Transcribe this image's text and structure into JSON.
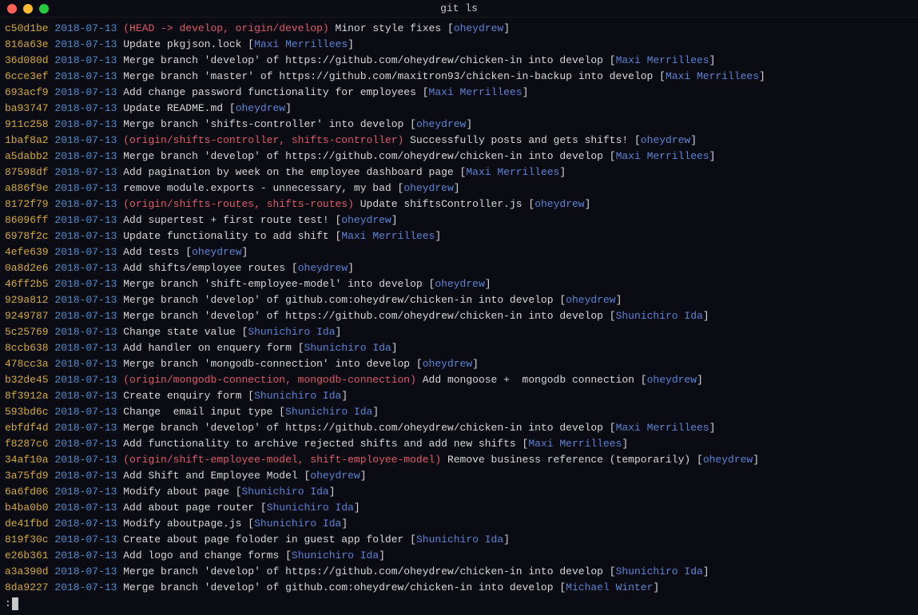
{
  "window": {
    "title": "git ls"
  },
  "commits": [
    {
      "hash": "c50d1be",
      "date": "2018-07-13",
      "refs": "(HEAD -> develop, origin/develop)",
      "msg": "Minor style fixes",
      "author": "oheydrew"
    },
    {
      "hash": "816a63e",
      "date": "2018-07-13",
      "refs": "",
      "msg": "Update pkgjson.lock",
      "author": "Maxi Merrillees"
    },
    {
      "hash": "36d080d",
      "date": "2018-07-13",
      "refs": "",
      "msg": "Merge branch 'develop' of https://github.com/oheydrew/chicken-in into develop",
      "author": "Maxi Merrillees"
    },
    {
      "hash": "6cce3ef",
      "date": "2018-07-13",
      "refs": "",
      "msg": "Merge branch 'master' of https://github.com/maxitron93/chicken-in-backup into develop",
      "author": "Maxi Merrillees"
    },
    {
      "hash": "693acf9",
      "date": "2018-07-13",
      "refs": "",
      "msg": "Add change password functionality for employees",
      "author": "Maxi Merrillees"
    },
    {
      "hash": "ba93747",
      "date": "2018-07-13",
      "refs": "",
      "msg": "Update README.md",
      "author": "oheydrew"
    },
    {
      "hash": "911c258",
      "date": "2018-07-13",
      "refs": "",
      "msg": "Merge branch 'shifts-controller' into develop",
      "author": "oheydrew"
    },
    {
      "hash": "1baf8a2",
      "date": "2018-07-13",
      "refs": "(origin/shifts-controller, shifts-controller)",
      "msg": "Successfully posts and gets shifts!",
      "author": "oheydrew"
    },
    {
      "hash": "a5dabb2",
      "date": "2018-07-13",
      "refs": "",
      "msg": "Merge branch 'develop' of https://github.com/oheydrew/chicken-in into develop",
      "author": "Maxi Merrillees"
    },
    {
      "hash": "87598df",
      "date": "2018-07-13",
      "refs": "",
      "msg": "Add pagination by week on the employee dashboard page",
      "author": "Maxi Merrillees"
    },
    {
      "hash": "a886f9e",
      "date": "2018-07-13",
      "refs": "",
      "msg": "remove module.exports - unnecessary, my bad",
      "author": "oheydrew"
    },
    {
      "hash": "8172f79",
      "date": "2018-07-13",
      "refs": "(origin/shifts-routes, shifts-routes)",
      "msg": "Update shiftsController.js",
      "author": "oheydrew"
    },
    {
      "hash": "86096ff",
      "date": "2018-07-13",
      "refs": "",
      "msg": "Add supertest + first route test!",
      "author": "oheydrew"
    },
    {
      "hash": "6978f2c",
      "date": "2018-07-13",
      "refs": "",
      "msg": "Update functionality to add shift",
      "author": "Maxi Merrillees"
    },
    {
      "hash": "4efe639",
      "date": "2018-07-13",
      "refs": "",
      "msg": "Add tests",
      "author": "oheydrew"
    },
    {
      "hash": "0a8d2e6",
      "date": "2018-07-13",
      "refs": "",
      "msg": "Add shifts/employee routes",
      "author": "oheydrew"
    },
    {
      "hash": "46ff2b5",
      "date": "2018-07-13",
      "refs": "",
      "msg": "Merge branch 'shift-employee-model' into develop",
      "author": "oheydrew"
    },
    {
      "hash": "929a812",
      "date": "2018-07-13",
      "refs": "",
      "msg": "Merge branch 'develop' of github.com:oheydrew/chicken-in into develop",
      "author": "oheydrew"
    },
    {
      "hash": "9249787",
      "date": "2018-07-13",
      "refs": "",
      "msg": "Merge branch 'develop' of https://github.com/oheydrew/chicken-in into develop",
      "author": "Shunichiro Ida"
    },
    {
      "hash": "5c25769",
      "date": "2018-07-13",
      "refs": "",
      "msg": "Change state value",
      "author": "Shunichiro Ida"
    },
    {
      "hash": "8ccb638",
      "date": "2018-07-13",
      "refs": "",
      "msg": "Add handler on enquery form",
      "author": "Shunichiro Ida"
    },
    {
      "hash": "478cc3a",
      "date": "2018-07-13",
      "refs": "",
      "msg": "Merge branch 'mongodb-connection' into develop",
      "author": "oheydrew"
    },
    {
      "hash": "b32de45",
      "date": "2018-07-13",
      "refs": "(origin/mongodb-connection, mongodb-connection)",
      "msg": "Add mongoose +  mongodb connection",
      "author": "oheydrew"
    },
    {
      "hash": "8f3912a",
      "date": "2018-07-13",
      "refs": "",
      "msg": "Create enquiry form",
      "author": "Shunichiro Ida"
    },
    {
      "hash": "593bd6c",
      "date": "2018-07-13",
      "refs": "",
      "msg": "Change  email input type",
      "author": "Shunichiro Ida"
    },
    {
      "hash": "ebfdf4d",
      "date": "2018-07-13",
      "refs": "",
      "msg": "Merge branch 'develop' of https://github.com/oheydrew/chicken-in into develop",
      "author": "Maxi Merrillees"
    },
    {
      "hash": "f8287c6",
      "date": "2018-07-13",
      "refs": "",
      "msg": "Add functionality to archive rejected shifts and add new shifts",
      "author": "Maxi Merrillees"
    },
    {
      "hash": "34af10a",
      "date": "2018-07-13",
      "refs": "(origin/shift-employee-model, shift-employee-model)",
      "msg": "Remove business reference (temporarily)",
      "author": "oheydrew"
    },
    {
      "hash": "3a75fd9",
      "date": "2018-07-13",
      "refs": "",
      "msg": "Add Shift and Employee Model",
      "author": "oheydrew"
    },
    {
      "hash": "6a6fd06",
      "date": "2018-07-13",
      "refs": "",
      "msg": "Modify about page",
      "author": "Shunichiro Ida"
    },
    {
      "hash": "b4ba0b0",
      "date": "2018-07-13",
      "refs": "",
      "msg": "Add about page router",
      "author": "Shunichiro Ida"
    },
    {
      "hash": "de41fbd",
      "date": "2018-07-13",
      "refs": "",
      "msg": "Modify aboutpage.js",
      "author": "Shunichiro Ida"
    },
    {
      "hash": "819f30c",
      "date": "2018-07-13",
      "refs": "",
      "msg": "Create about page foloder in guest app folder",
      "author": "Shunichiro Ida"
    },
    {
      "hash": "e26b361",
      "date": "2018-07-13",
      "refs": "",
      "msg": "Add logo and change forms",
      "author": "Shunichiro Ida"
    },
    {
      "hash": "a3a390d",
      "date": "2018-07-13",
      "refs": "",
      "msg": "Merge branch 'develop' of https://github.com/oheydrew/chicken-in into develop",
      "author": "Shunichiro Ida"
    },
    {
      "hash": "8da9227",
      "date": "2018-07-13",
      "refs": "",
      "msg": "Merge branch 'develop' of github.com:oheydrew/chicken-in into develop",
      "author": "Michael Winter"
    }
  ],
  "prompt": ":"
}
